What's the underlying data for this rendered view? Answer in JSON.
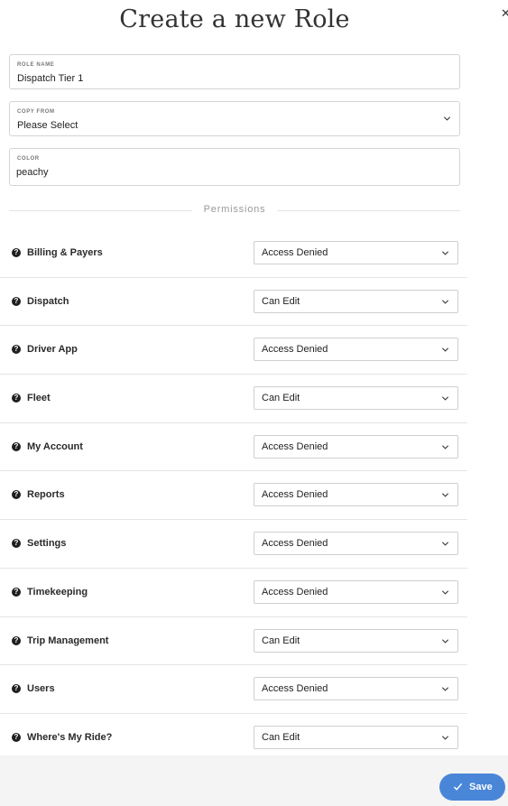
{
  "dialog": {
    "title": "Create a new Role"
  },
  "form": {
    "role_name": {
      "label": "ROLE NAME",
      "value": "Dispatch Tier 1"
    },
    "copy_from": {
      "label": "COPY FROM",
      "value": "Please Select"
    },
    "color": {
      "label": "COLOR",
      "value": "peachy"
    }
  },
  "permissions": {
    "heading": "Permissions",
    "items": [
      {
        "label": "Billing & Payers",
        "value": "Access Denied"
      },
      {
        "label": "Dispatch",
        "value": "Can Edit"
      },
      {
        "label": "Driver App",
        "value": "Access Denied"
      },
      {
        "label": "Fleet",
        "value": "Can Edit"
      },
      {
        "label": "My Account",
        "value": "Access Denied"
      },
      {
        "label": "Reports",
        "value": "Access Denied"
      },
      {
        "label": "Settings",
        "value": "Access Denied"
      },
      {
        "label": "Timekeeping",
        "value": "Access Denied"
      },
      {
        "label": "Trip Management",
        "value": "Can Edit"
      },
      {
        "label": "Users",
        "value": "Access Denied"
      },
      {
        "label": "Where's My Ride?",
        "value": "Can Edit"
      }
    ]
  },
  "footer": {
    "save_label": "Save"
  },
  "icons": {
    "close": "close-icon",
    "help": "question-circle-icon",
    "chevron": "chevron-down-icon",
    "save": "check-icon"
  },
  "colors": {
    "accent": "#4a86d8",
    "footer_bg": "#f4f4f4",
    "border": "#d4d4d4"
  }
}
